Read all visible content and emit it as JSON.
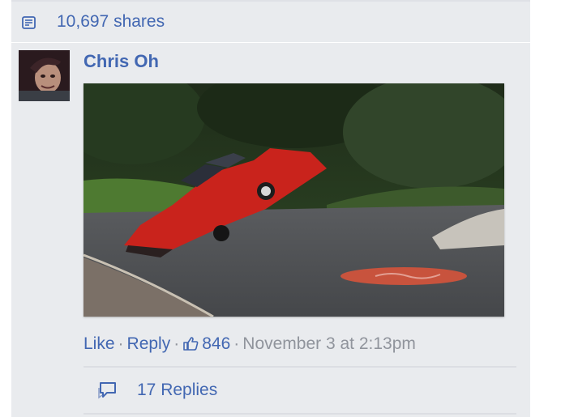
{
  "shares": {
    "label": "10,697 shares",
    "icon": "share-list-icon"
  },
  "comment": {
    "author": "Chris Oh",
    "actions": {
      "like": "Like",
      "reply": "Reply",
      "like_count": "846",
      "timestamp": "November 3 at 2:13pm"
    },
    "replies": {
      "label": "17 Replies",
      "icon": "replies-bubble-icon"
    }
  },
  "colors": {
    "link": "#4267b2",
    "meta": "#90949c",
    "panel": "#e9ebee"
  }
}
